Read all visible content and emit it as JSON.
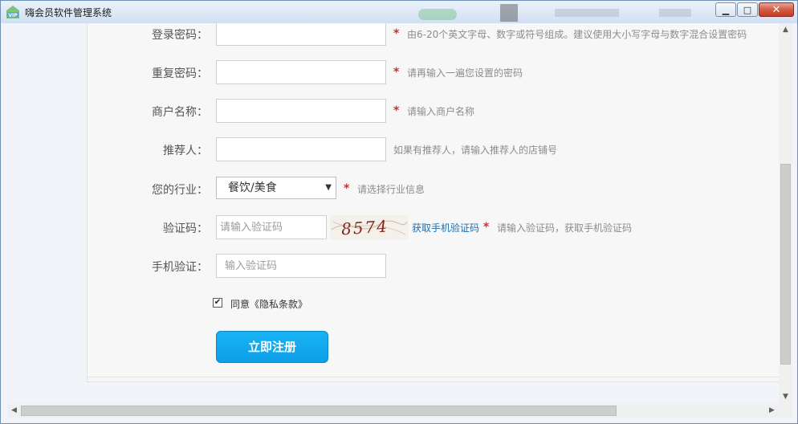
{
  "window": {
    "title": "嗨会员软件管理系统",
    "buttons": {
      "minimize": "▁",
      "maximize": "□",
      "close": "✕"
    }
  },
  "form": {
    "password": {
      "label": "登录密码：",
      "value": "",
      "hint": "由6-20个英文字母、数字或符号组成。建议使用大小写字母与数字混合设置密码",
      "required": true
    },
    "confirm_password": {
      "label": "重复密码：",
      "value": "",
      "hint": "请再输入一遍您设置的密码",
      "required": true
    },
    "merchant_name": {
      "label": "商户名称：",
      "value": "",
      "hint": "请输入商户名称",
      "required": true
    },
    "referrer": {
      "label": "推荐人：",
      "value": "",
      "hint": "如果有推荐人，请输入推荐人的店铺号",
      "required": false
    },
    "industry": {
      "label": "您的行业：",
      "selected": "餐饮/美食",
      "hint": "请选择行业信息",
      "required": true
    },
    "captcha": {
      "label": "验证码：",
      "placeholder": "请输入验证码",
      "image_text": "8574",
      "sms_link": "获取手机验证码",
      "hint": "请输入验证码，获取手机验证码",
      "required": true
    },
    "sms_code": {
      "label": "手机验证：",
      "placeholder": "输入验证码"
    },
    "agreement": {
      "checked": true,
      "mark": "✔",
      "text": "同意《隐私条款》"
    },
    "submit_label": "立即注册",
    "required_mark": "*"
  },
  "colors": {
    "accent": "#0d9fe8",
    "required": "#d6282d",
    "link": "#1b6fb3",
    "hint": "#8c8c8c"
  }
}
